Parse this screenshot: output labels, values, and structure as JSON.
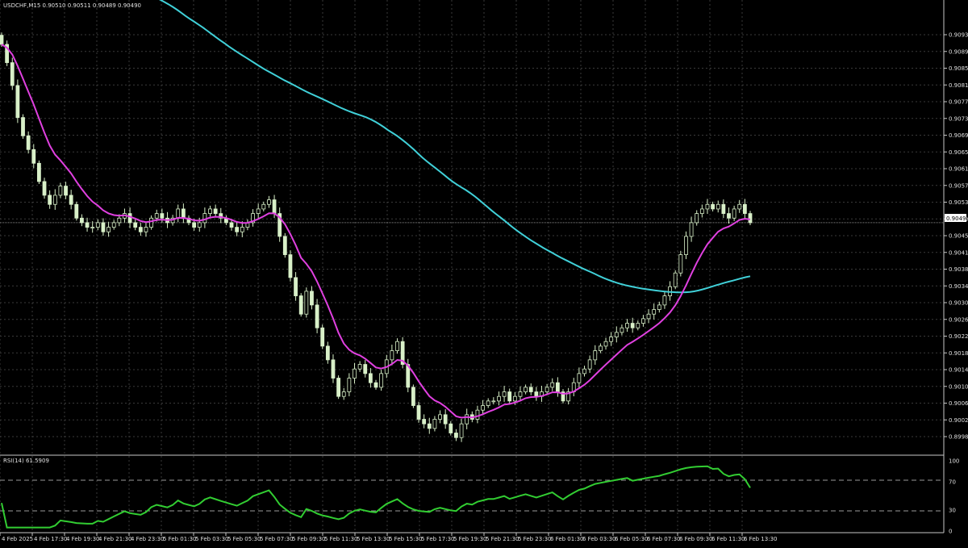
{
  "main_panel": {
    "header": "USDCHF,M15  0.90510 0.90511 0.90489 0.90490",
    "price_ticks": [
      "0.90930",
      "0.90890",
      "0.90850",
      "0.90810",
      "0.90770",
      "0.90730",
      "0.90695",
      "0.90655",
      "0.90615",
      "0.90575",
      "0.90535",
      "0.90495",
      "0.90455",
      "0.90415",
      "0.90380",
      "0.90340",
      "0.90300",
      "0.90260",
      "0.90220",
      "0.90180",
      "0.90140",
      "0.90100",
      "0.90065",
      "0.90025",
      "0.89985"
    ],
    "current_price": "0.90490"
  },
  "rsi_panel": {
    "header": "RSI(14) 61.5909",
    "ticks": [
      "100",
      "70",
      "30",
      "0"
    ]
  },
  "time_axis": {
    "labels": [
      "4 Feb 2025",
      "4 Feb 17:30",
      "4 Feb 19:30",
      "4 Feb 21:30",
      "4 Feb 23:30",
      "5 Feb 01:30",
      "5 Feb 03:30",
      "5 Feb 05:30",
      "5 Feb 07:30",
      "5 Feb 09:30",
      "5 Feb 11:30",
      "5 Feb 13:30",
      "5 Feb 15:30",
      "5 Feb 17:30",
      "5 Feb 19:30",
      "5 Feb 21:30",
      "5 Feb 23:30",
      "6 Feb 01:30",
      "6 Feb 03:30",
      "6 Feb 05:30",
      "6 Feb 07:30",
      "6 Feb 09:30",
      "6 Feb 11:30",
      "6 Feb 13:30"
    ]
  },
  "colors": {
    "background": "#000000",
    "grid": "#3a3a3a",
    "candles": "#d8f0c8",
    "ma_fast": "#e040e0",
    "ma_slow": "#40d0d8",
    "rsi_line": "#32cd32",
    "axis_text": "#e0e0e0"
  },
  "chart_data": {
    "type": "candlestick",
    "symbol": "USDCHF",
    "timeframe": "M15",
    "last_ohlc": {
      "open": 0.9051,
      "high": 0.90511,
      "low": 0.90489,
      "close": 0.9049
    },
    "ylim": [
      0.89985,
      0.9097
    ],
    "closes": [
      0.9088,
      0.9084,
      0.9079,
      0.9072,
      0.9068,
      0.9065,
      0.9062,
      0.9058,
      0.9055,
      0.9053,
      0.9055,
      0.9057,
      0.9055,
      0.9053,
      0.905,
      0.9049,
      0.9048,
      0.9048,
      0.9049,
      0.9047,
      0.9048,
      0.9049,
      0.905,
      0.9051,
      0.9049,
      0.9048,
      0.9047,
      0.9048,
      0.905,
      0.9051,
      0.905,
      0.9049,
      0.905,
      0.9052,
      0.905,
      0.9049,
      0.9048,
      0.9049,
      0.9051,
      0.9052,
      0.9051,
      0.905,
      0.9049,
      0.9048,
      0.9047,
      0.9048,
      0.9049,
      0.9051,
      0.9052,
      0.9053,
      0.9054,
      0.9051,
      0.9046,
      0.9042,
      0.9037,
      0.9033,
      0.9029,
      0.9034,
      0.9031,
      0.9026,
      0.9022,
      0.9019,
      0.9015,
      0.9011,
      0.9012,
      0.9015,
      0.9017,
      0.9018,
      0.9016,
      0.9014,
      0.9013,
      0.9016,
      0.9019,
      0.9021,
      0.9023,
      0.9018,
      0.9013,
      0.9009,
      0.9006,
      0.9005,
      0.9004,
      0.9006,
      0.9007,
      0.9005,
      0.9003,
      0.9002,
      0.9005,
      0.9007,
      0.9006,
      0.9008,
      0.9009,
      0.901,
      0.901,
      0.9011,
      0.9012,
      0.901,
      0.9011,
      0.9012,
      0.9013,
      0.9012,
      0.9011,
      0.9012,
      0.9013,
      0.9014,
      0.9012,
      0.901,
      0.9012,
      0.9014,
      0.9016,
      0.9017,
      0.9019,
      0.9021,
      0.9022,
      0.9023,
      0.9024,
      0.9025,
      0.9026,
      0.9027,
      0.9026,
      0.9027,
      0.9028,
      0.9029,
      0.903,
      0.9031,
      0.9033,
      0.9035,
      0.9038,
      0.9042,
      0.9046,
      0.9049,
      0.9051,
      0.9052,
      0.9053,
      0.9052,
      0.9053,
      0.9051,
      0.905,
      0.9052,
      0.9053,
      0.9051,
      0.9049
    ],
    "rsi_last": 61.5909,
    "rsi_levels": [
      70,
      30
    ],
    "rsi_ylim": [
      0,
      100
    ]
  }
}
